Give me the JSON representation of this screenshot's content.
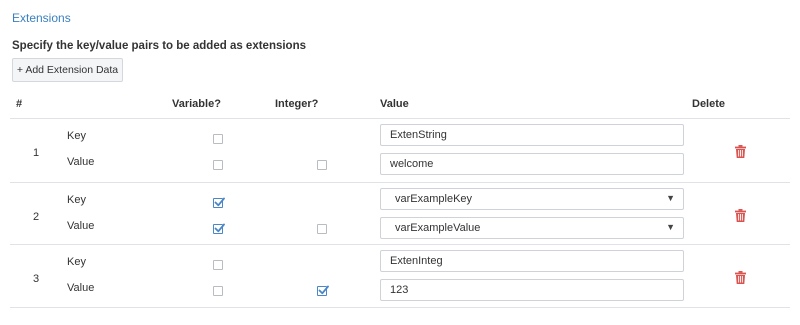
{
  "section_title": "Extensions",
  "hint": "Specify the key/value pairs to be added as extensions",
  "add_button_label": "+ Add Extension Data",
  "columns": {
    "num": "#",
    "variable": "Variable?",
    "integer": "Integer?",
    "value": "Value",
    "delete": "Delete"
  },
  "key_label": "Key",
  "value_label": "Value",
  "rows": [
    {
      "index": "1",
      "key": {
        "variable": false,
        "text": "ExtenString",
        "type": "text"
      },
      "value": {
        "variable": false,
        "integer": false,
        "text": "welcome",
        "type": "text"
      }
    },
    {
      "index": "2",
      "key": {
        "variable": true,
        "text": "varExampleKey",
        "type": "select"
      },
      "value": {
        "variable": true,
        "integer": false,
        "text": "varExampleValue",
        "type": "select"
      }
    },
    {
      "index": "3",
      "key": {
        "variable": false,
        "text": "ExtenInteg",
        "type": "text"
      },
      "value": {
        "variable": false,
        "integer": true,
        "text": "123",
        "type": "text"
      }
    }
  ],
  "colors": {
    "accent": "#3a7fc1",
    "delete_icon": "#d9534f",
    "check": "#4a86c8"
  },
  "icons": {
    "dropdown": "▼",
    "delete": "trash-icon",
    "check": "checkmark-icon"
  }
}
